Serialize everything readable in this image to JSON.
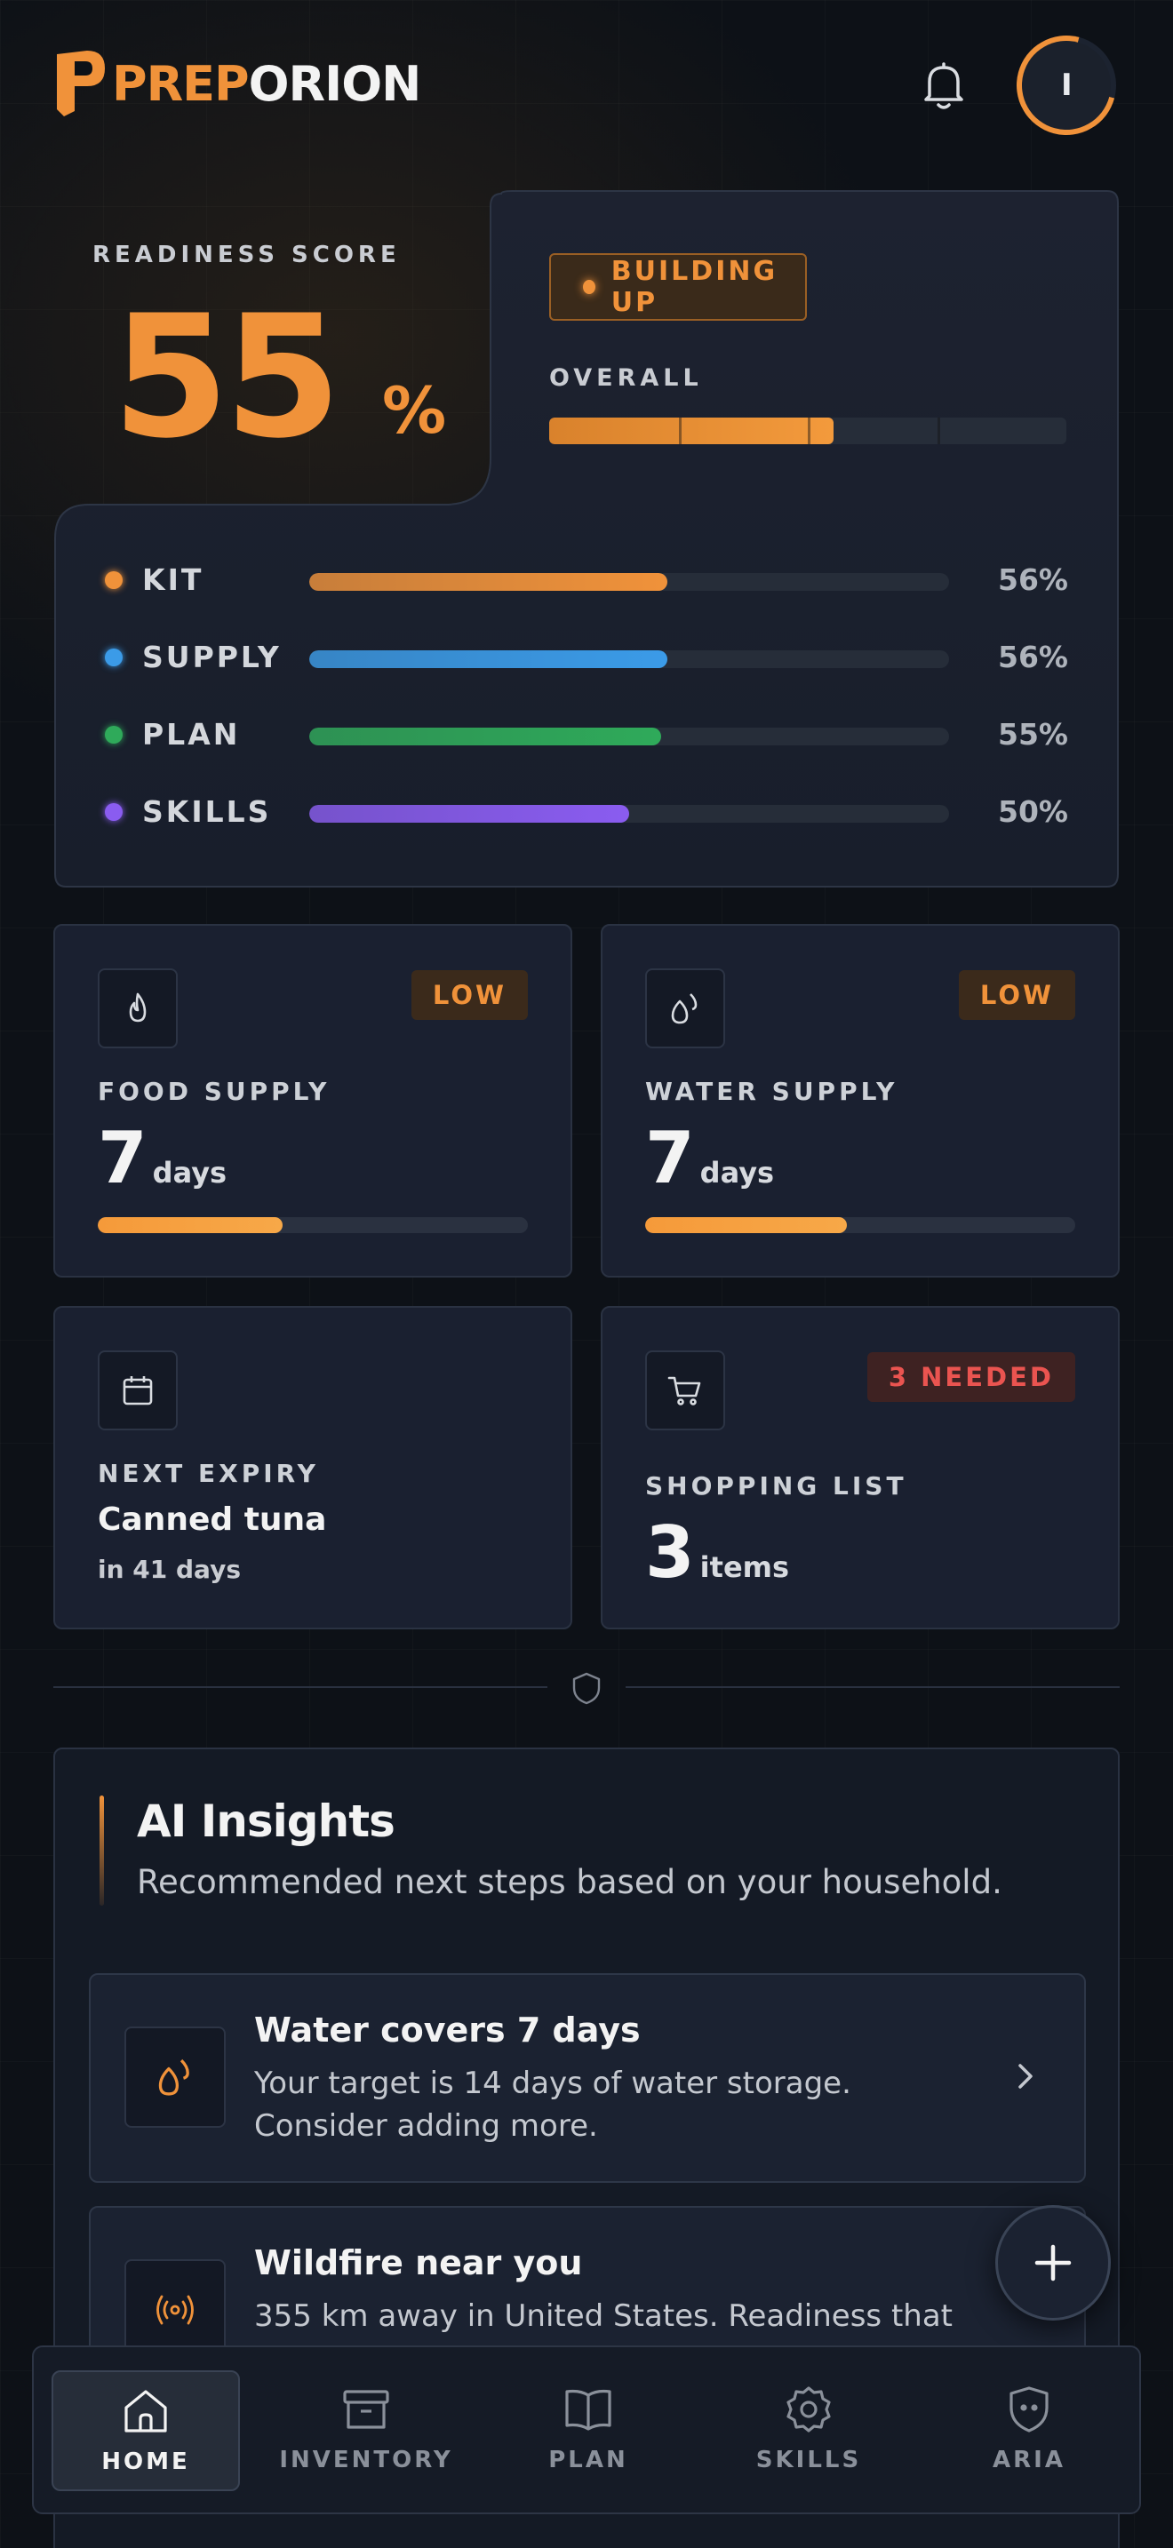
{
  "header": {
    "logo_a": "PREP",
    "logo_b": "ORION",
    "avatar_initial": "I"
  },
  "readiness": {
    "score_label": "READINESS SCORE",
    "score": "55",
    "percent_sign": "%",
    "status_badge": "BUILDING UP",
    "overall_label": "OVERALL",
    "overall_fraction": 0.55,
    "categories": [
      {
        "name": "KIT",
        "value": "56%",
        "fraction": 0.56,
        "color": "#f0923a"
      },
      {
        "name": "SUPPLY",
        "value": "56%",
        "fraction": 0.56,
        "color": "#3b9be8"
      },
      {
        "name": "PLAN",
        "value": "55%",
        "fraction": 0.55,
        "color": "#2faa5a"
      },
      {
        "name": "SKILLS",
        "value": "50%",
        "fraction": 0.5,
        "color": "#8a5cf0"
      }
    ]
  },
  "cards": {
    "food": {
      "badge": "LOW",
      "label": "FOOD SUPPLY",
      "value": "7",
      "unit": "days",
      "fraction": 0.43
    },
    "water": {
      "badge": "LOW",
      "label": "WATER SUPPLY",
      "value": "7",
      "unit": "days",
      "fraction": 0.47
    },
    "expiry": {
      "label": "NEXT EXPIRY",
      "item": "Canned tuna",
      "when": "in 41 days"
    },
    "shopping": {
      "badge": "3 NEEDED",
      "label": "SHOPPING LIST",
      "value": "3",
      "unit": "items"
    }
  },
  "insights": {
    "title": "AI Insights",
    "subtitle": "Recommended next steps based on your household.",
    "items": [
      {
        "title": "Water covers 7 days",
        "body": "Your target is 14 days of water storage. Consider adding more.",
        "icon": "water-drops-icon"
      },
      {
        "title": "Wildfire near you",
        "body": "355 km away in United States. Readiness that",
        "icon": "broadcast-icon"
      }
    ]
  },
  "nav": {
    "items": [
      {
        "label": "HOME",
        "icon": "home-icon",
        "active": true
      },
      {
        "label": "INVENTORY",
        "icon": "archive-icon",
        "active": false
      },
      {
        "label": "PLAN",
        "icon": "book-icon",
        "active": false
      },
      {
        "label": "SKILLS",
        "icon": "badge-gear-icon",
        "active": false
      },
      {
        "label": "ARIA",
        "icon": "aria-shield-icon",
        "active": false
      }
    ]
  },
  "colors": {
    "accent": "#f0923a",
    "danger": "#ea5450",
    "background": "#0d1117"
  }
}
